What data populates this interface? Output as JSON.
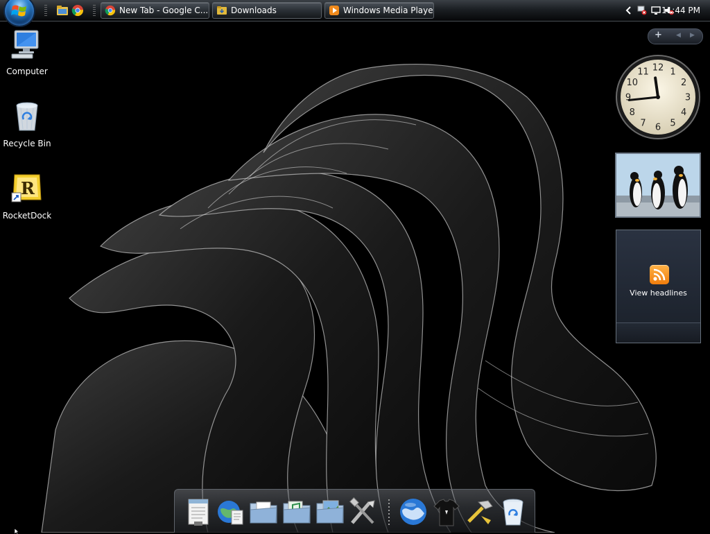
{
  "taskbar": {
    "start_label": "Start",
    "quick_launch": [
      {
        "name": "explorer-icon"
      },
      {
        "name": "chrome-icon"
      }
    ],
    "tasks": [
      {
        "label": "New Tab - Google C...",
        "icon": "chrome-icon"
      },
      {
        "label": "Downloads",
        "icon": "folder-icon"
      },
      {
        "label": "Windows Media Player",
        "icon": "media-player-icon"
      }
    ],
    "tray": {
      "time": "11:44 PM",
      "icons": [
        "show-hidden-icons",
        "network-error-icon",
        "display-icon",
        "volume-muted-icon"
      ]
    }
  },
  "desktop_icons": [
    {
      "label": "Computer",
      "icon": "computer-icon"
    },
    {
      "label": "Recycle Bin",
      "icon": "recycle-bin-icon"
    },
    {
      "label": "RocketDock",
      "icon": "rocketdock-icon"
    }
  ],
  "sidebar": {
    "controls": {
      "add": "+",
      "prev": "◀",
      "next": "▶"
    },
    "clock_gadget": {
      "hour": 11,
      "minute": 44,
      "numbers": [
        "12",
        "1",
        "2",
        "3",
        "4",
        "5",
        "6",
        "7",
        "8",
        "9",
        "10",
        "11"
      ]
    },
    "slideshow_gadget": {
      "subject": "penguins"
    },
    "feed_gadget": {
      "label": "View headlines",
      "icon": "rss-icon"
    }
  },
  "dock": {
    "items": [
      {
        "name": "notepad-icon"
      },
      {
        "name": "web-document-icon"
      },
      {
        "name": "documents-folder-icon"
      },
      {
        "name": "music-folder-icon"
      },
      {
        "name": "pictures-folder-icon"
      },
      {
        "name": "tools-icon"
      },
      {
        "name": "internet-globe-icon"
      },
      {
        "name": "tshirt-icon"
      },
      {
        "name": "hammer-icon"
      },
      {
        "name": "recycle-bin-icon"
      }
    ]
  },
  "colors": {
    "accent": "#2a7ec8",
    "rss": "#f07d0d",
    "taskbar": "#1b1f23"
  }
}
